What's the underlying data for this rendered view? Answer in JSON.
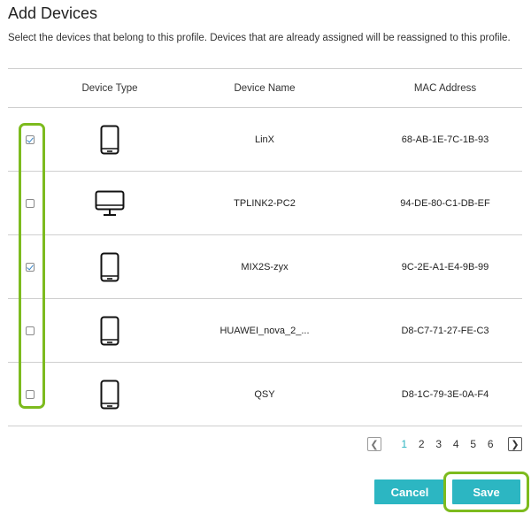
{
  "dialog": {
    "title": "Add Devices",
    "description": "Select the devices that belong to this profile. Devices that are already assigned will be reassigned to this profile."
  },
  "table": {
    "headers": {
      "device_type": "Device Type",
      "device_name": "Device Name",
      "mac_address": "MAC Address"
    },
    "rows": [
      {
        "checked": true,
        "device_type_icon": "smartphone-icon",
        "name": "LinX",
        "mac": "68-AB-1E-7C-1B-93"
      },
      {
        "checked": false,
        "device_type_icon": "desktop-pc-icon",
        "name": "TPLINK2-PC2",
        "mac": "94-DE-80-C1-DB-EF"
      },
      {
        "checked": true,
        "device_type_icon": "smartphone-icon",
        "name": "MIX2S-zyx",
        "mac": "9C-2E-A1-E4-9B-99"
      },
      {
        "checked": false,
        "device_type_icon": "smartphone-icon",
        "name": "HUAWEI_nova_2_...",
        "mac": "D8-C7-71-27-FE-C3"
      },
      {
        "checked": false,
        "device_type_icon": "smartphone-icon",
        "name": "QSY",
        "mac": "D8-1C-79-3E-0A-F4"
      }
    ]
  },
  "pagination": {
    "prev_icon": "chevron-left-icon",
    "next_icon": "chevron-right-icon",
    "pages": [
      "1",
      "2",
      "3",
      "4",
      "5",
      "6"
    ],
    "current_page": "1"
  },
  "actions": {
    "cancel_label": "Cancel",
    "save_label": "Save"
  },
  "colors": {
    "accent": "#2cb6c2",
    "highlight": "#7dbb1e",
    "check": "#3a86c8"
  }
}
